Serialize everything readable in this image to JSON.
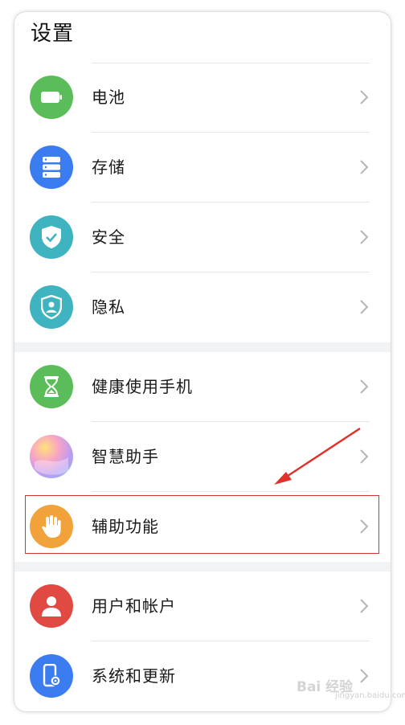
{
  "header": {
    "title": "设置"
  },
  "items": [
    {
      "label": "电池",
      "icon": "battery-icon",
      "color": "#5bbd5a"
    },
    {
      "label": "存储",
      "icon": "storage-icon",
      "color": "#3b7cf0"
    },
    {
      "label": "安全",
      "icon": "shield-check-icon",
      "color": "#40b3c0"
    },
    {
      "label": "隐私",
      "icon": "privacy-shield-icon",
      "color": "#40b3c0"
    },
    {
      "label": "健康使用手机",
      "icon": "hourglass-icon",
      "color": "#5bbd5a"
    },
    {
      "label": "智慧助手",
      "icon": "smart-assistant-icon",
      "color": "#c8a8ee"
    },
    {
      "label": "辅助功能",
      "icon": "hand-icon",
      "color": "#f2a23a"
    },
    {
      "label": "用户和帐户",
      "icon": "user-icon",
      "color": "#e04a42"
    },
    {
      "label": "系统和更新",
      "icon": "phone-settings-icon",
      "color": "#3b7cf0"
    }
  ],
  "annotation": {
    "highlight_color": "#d9342b"
  },
  "watermark": {
    "text": "Bai 经验",
    "sub": "jingyan.baidu.com"
  }
}
